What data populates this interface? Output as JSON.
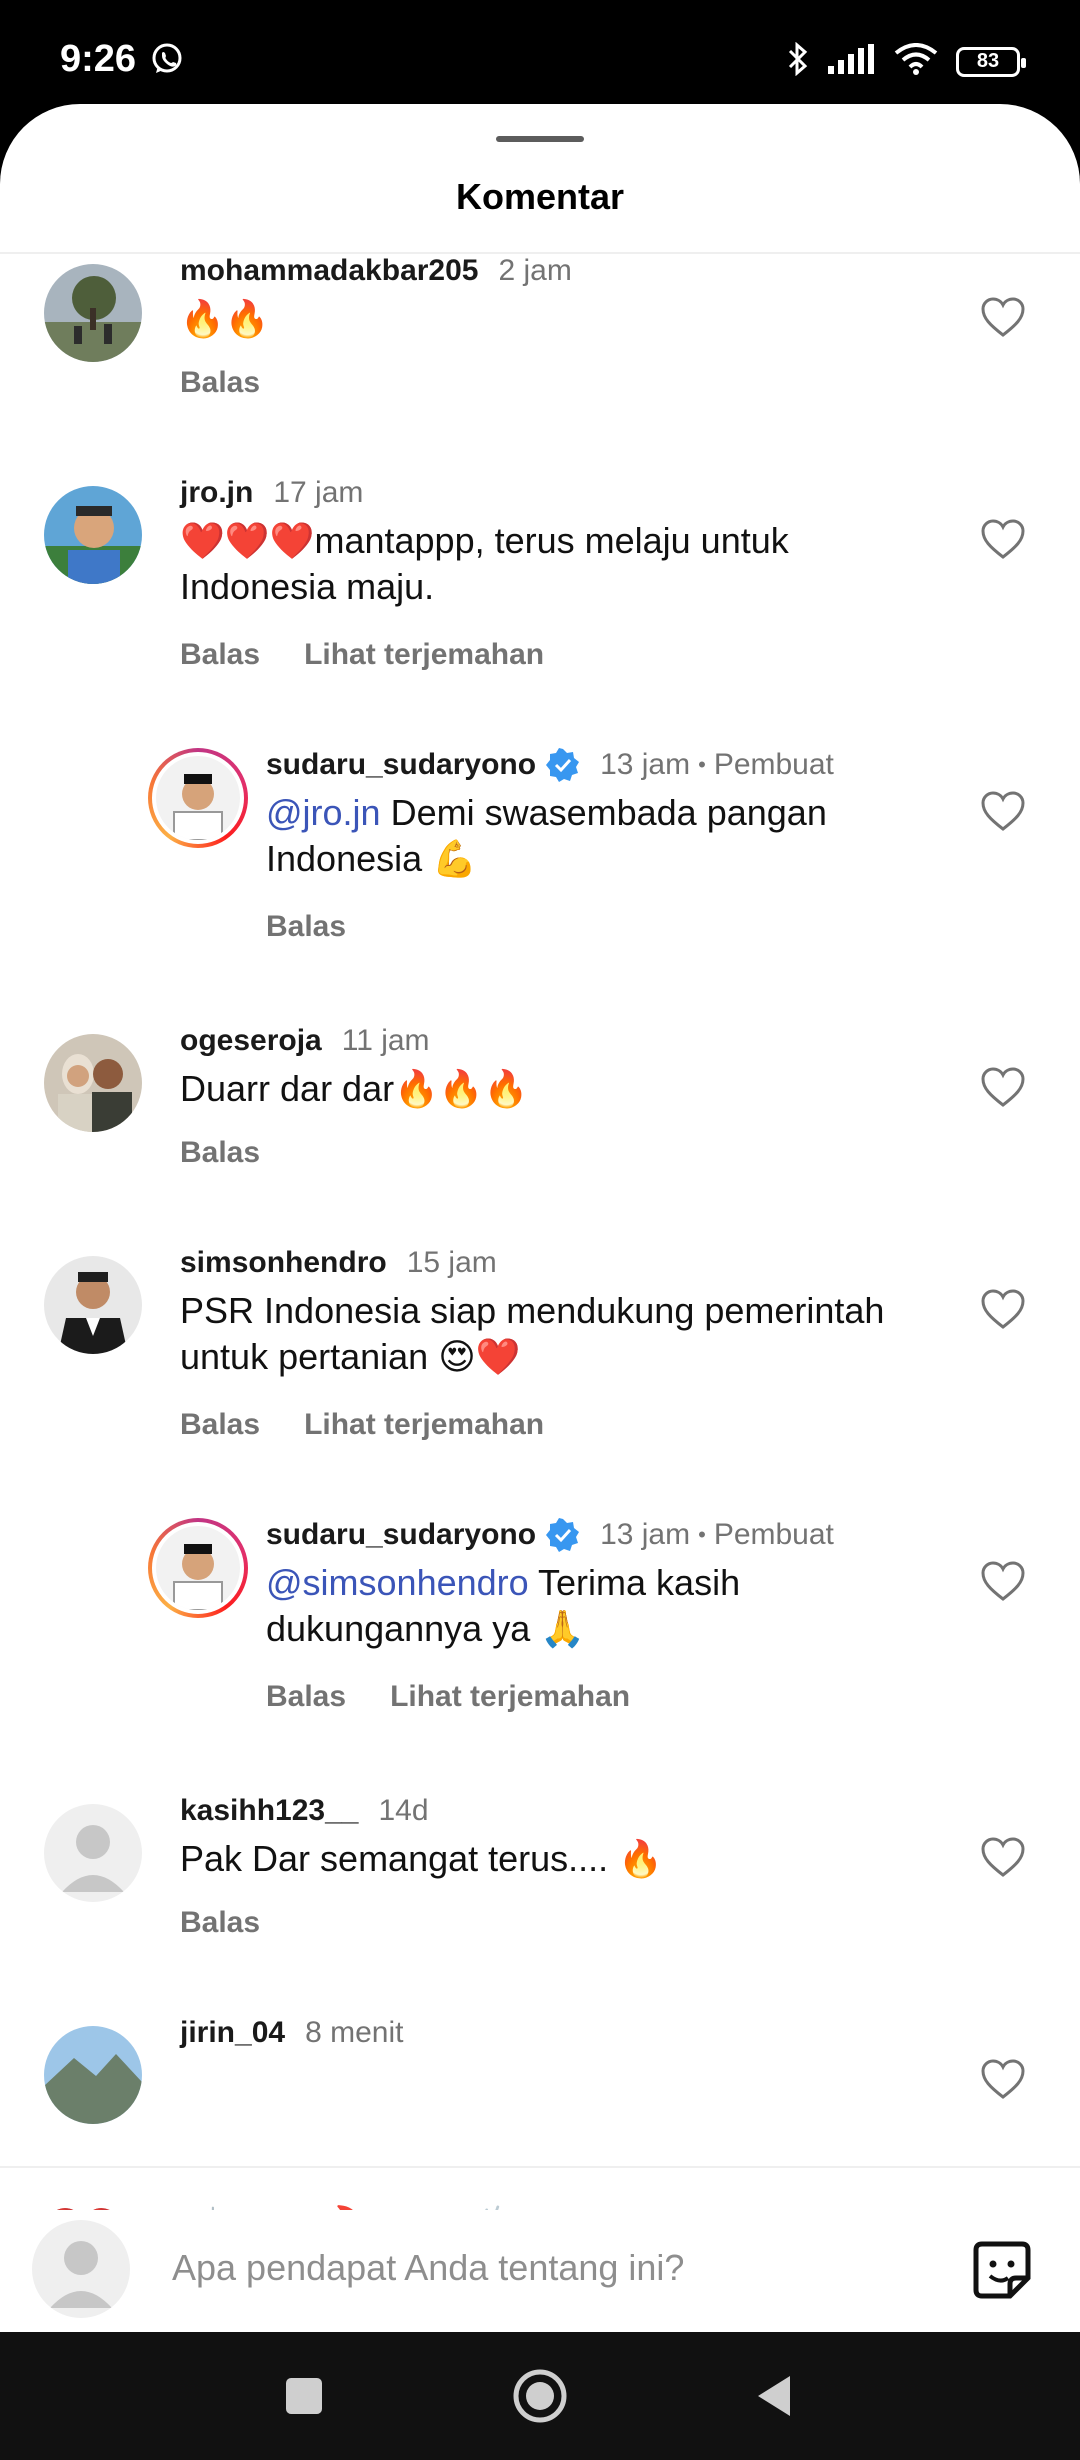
{
  "status_bar": {
    "time": "9:26",
    "battery": "83"
  },
  "sheet": {
    "title": "Komentar"
  },
  "comments": [
    {
      "username": "mohammadakbar205",
      "time": "2 jam",
      "text": "🔥🔥",
      "actions": [
        "Balas"
      ]
    },
    {
      "username": "jro.jn",
      "time": "17 jam",
      "text": "❤️❤️❤️mantappp, terus melaju untuk Indonesia maju.",
      "actions": [
        "Balas",
        "Lihat terjemahan"
      ]
    },
    {
      "username": "sudaru_sudaryono",
      "time": "13 jam",
      "badge": "Pembuat",
      "mention": "@jro.jn",
      "text": " Demi swasembada pangan Indonesia 💪",
      "actions": [
        "Balas"
      ]
    },
    {
      "username": "ogeseroja",
      "time": "11 jam",
      "text": "Duarr dar dar🔥🔥🔥",
      "actions": [
        "Balas"
      ]
    },
    {
      "username": "simsonhendro",
      "time": "15 jam",
      "text": "PSR Indonesia siap mendukung pemerintah untuk pertanian 😍❤️",
      "actions": [
        "Balas",
        "Lihat terjemahan"
      ]
    },
    {
      "username": "sudaru_sudaryono",
      "time": "13 jam",
      "badge": "Pembuat",
      "mention": "@simsonhendro",
      "text": " Terima kasih dukungannya ya 🙏",
      "actions": [
        "Balas",
        "Lihat terjemahan"
      ]
    },
    {
      "username": "kasihh123__",
      "time": "14d",
      "text": "Pak Dar semangat terus.... 🔥",
      "actions": [
        "Balas"
      ]
    },
    {
      "username": "jirin_04",
      "time": "8 menit"
    }
  ],
  "reactions": [
    "❤️",
    "🙌",
    "🔥",
    "👏",
    "😢",
    "😍",
    "😮",
    "😂"
  ],
  "composer": {
    "placeholder": "Apa pendapat Anda tentang ini?"
  },
  "icons": {
    "like": "heart-outline-icon",
    "verified": "verified-badge-icon",
    "sticker": "sticker-icon"
  }
}
